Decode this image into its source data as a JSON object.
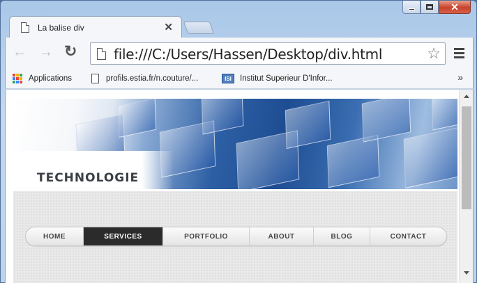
{
  "window": {
    "close_glyph": "✕"
  },
  "tab": {
    "title": "La balise div",
    "close_glyph": "✕"
  },
  "toolbar": {
    "back_glyph": "←",
    "forward_glyph": "→",
    "reload_glyph": "↻",
    "url": "file:///C:/Users/Hassen/Desktop/div.html",
    "star_glyph": "☆"
  },
  "bookmarks": {
    "items": [
      {
        "label": "Applications",
        "icon": "apps-grid-icon"
      },
      {
        "label": "profils.estia.fr/n.couture/...",
        "icon": "page-icon"
      },
      {
        "label": "Institut Superieur D'Infor...",
        "icon": "isi-logo-icon",
        "logo_text": "ISI"
      }
    ],
    "more_glyph": "»"
  },
  "page": {
    "banner_title": "TECHNOLOGIE",
    "nav": [
      {
        "label": "HOME",
        "active": false
      },
      {
        "label": "SERVICES",
        "active": true
      },
      {
        "label": "PORTFOLIO",
        "active": false
      },
      {
        "label": "ABOUT",
        "active": false
      },
      {
        "label": "BLOG",
        "active": false
      },
      {
        "label": "CONTACT",
        "active": false
      }
    ]
  },
  "colors": {
    "nav_active_bg": "#2b2b2b",
    "banner_blue": "#1e4d92",
    "apps_grid": [
      "#e8453c",
      "#f5b400",
      "#3ba55c",
      "#4285f4",
      "#e8453c",
      "#f5b400",
      "#3ba55c",
      "#4285f4",
      "#e8453c"
    ]
  }
}
